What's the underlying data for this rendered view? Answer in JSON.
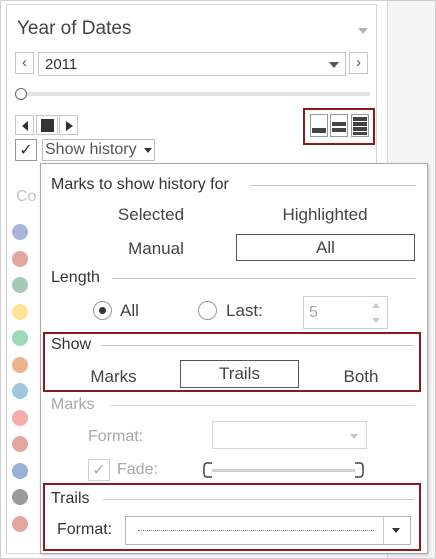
{
  "filter_card": {
    "title": "Year of Dates",
    "year_value": "2011",
    "prev_symbol": "‹",
    "next_symbol": "›",
    "show_history_label": "Show history",
    "show_history_checked": true,
    "check_mark": "✓",
    "dimension_label": "Co",
    "dimension_flags": [
      "#3b5ea8",
      "#c0392b",
      "#2e8b57",
      "#f1c40f",
      "#27ae60",
      "#d35400",
      "#2980b9",
      "#e74c3c",
      "#c0392b",
      "#1f4fa3",
      "#222222",
      "#c0392b"
    ]
  },
  "history_panel": {
    "marks_section_title": "Marks to show history for",
    "marks_options": [
      "Selected",
      "Highlighted",
      "Manual",
      "All"
    ],
    "marks_selected": "All",
    "length_title": "Length",
    "length_all_label": "All",
    "length_last_label": "Last:",
    "length_last_value": "5",
    "length_selected": "All",
    "show_title": "Show",
    "show_options": [
      "Marks",
      "Trails",
      "Both"
    ],
    "show_selected": "Trails",
    "marks_fmt_title": "Marks",
    "marks_format_label": "Format:",
    "fade_label": "Fade:",
    "fade_checked": true,
    "trails_title": "Trails",
    "trails_format_label": "Format:"
  },
  "colors": {
    "highlight_border": "#8b1a1a",
    "disabled_text": "#a8a8a8"
  }
}
